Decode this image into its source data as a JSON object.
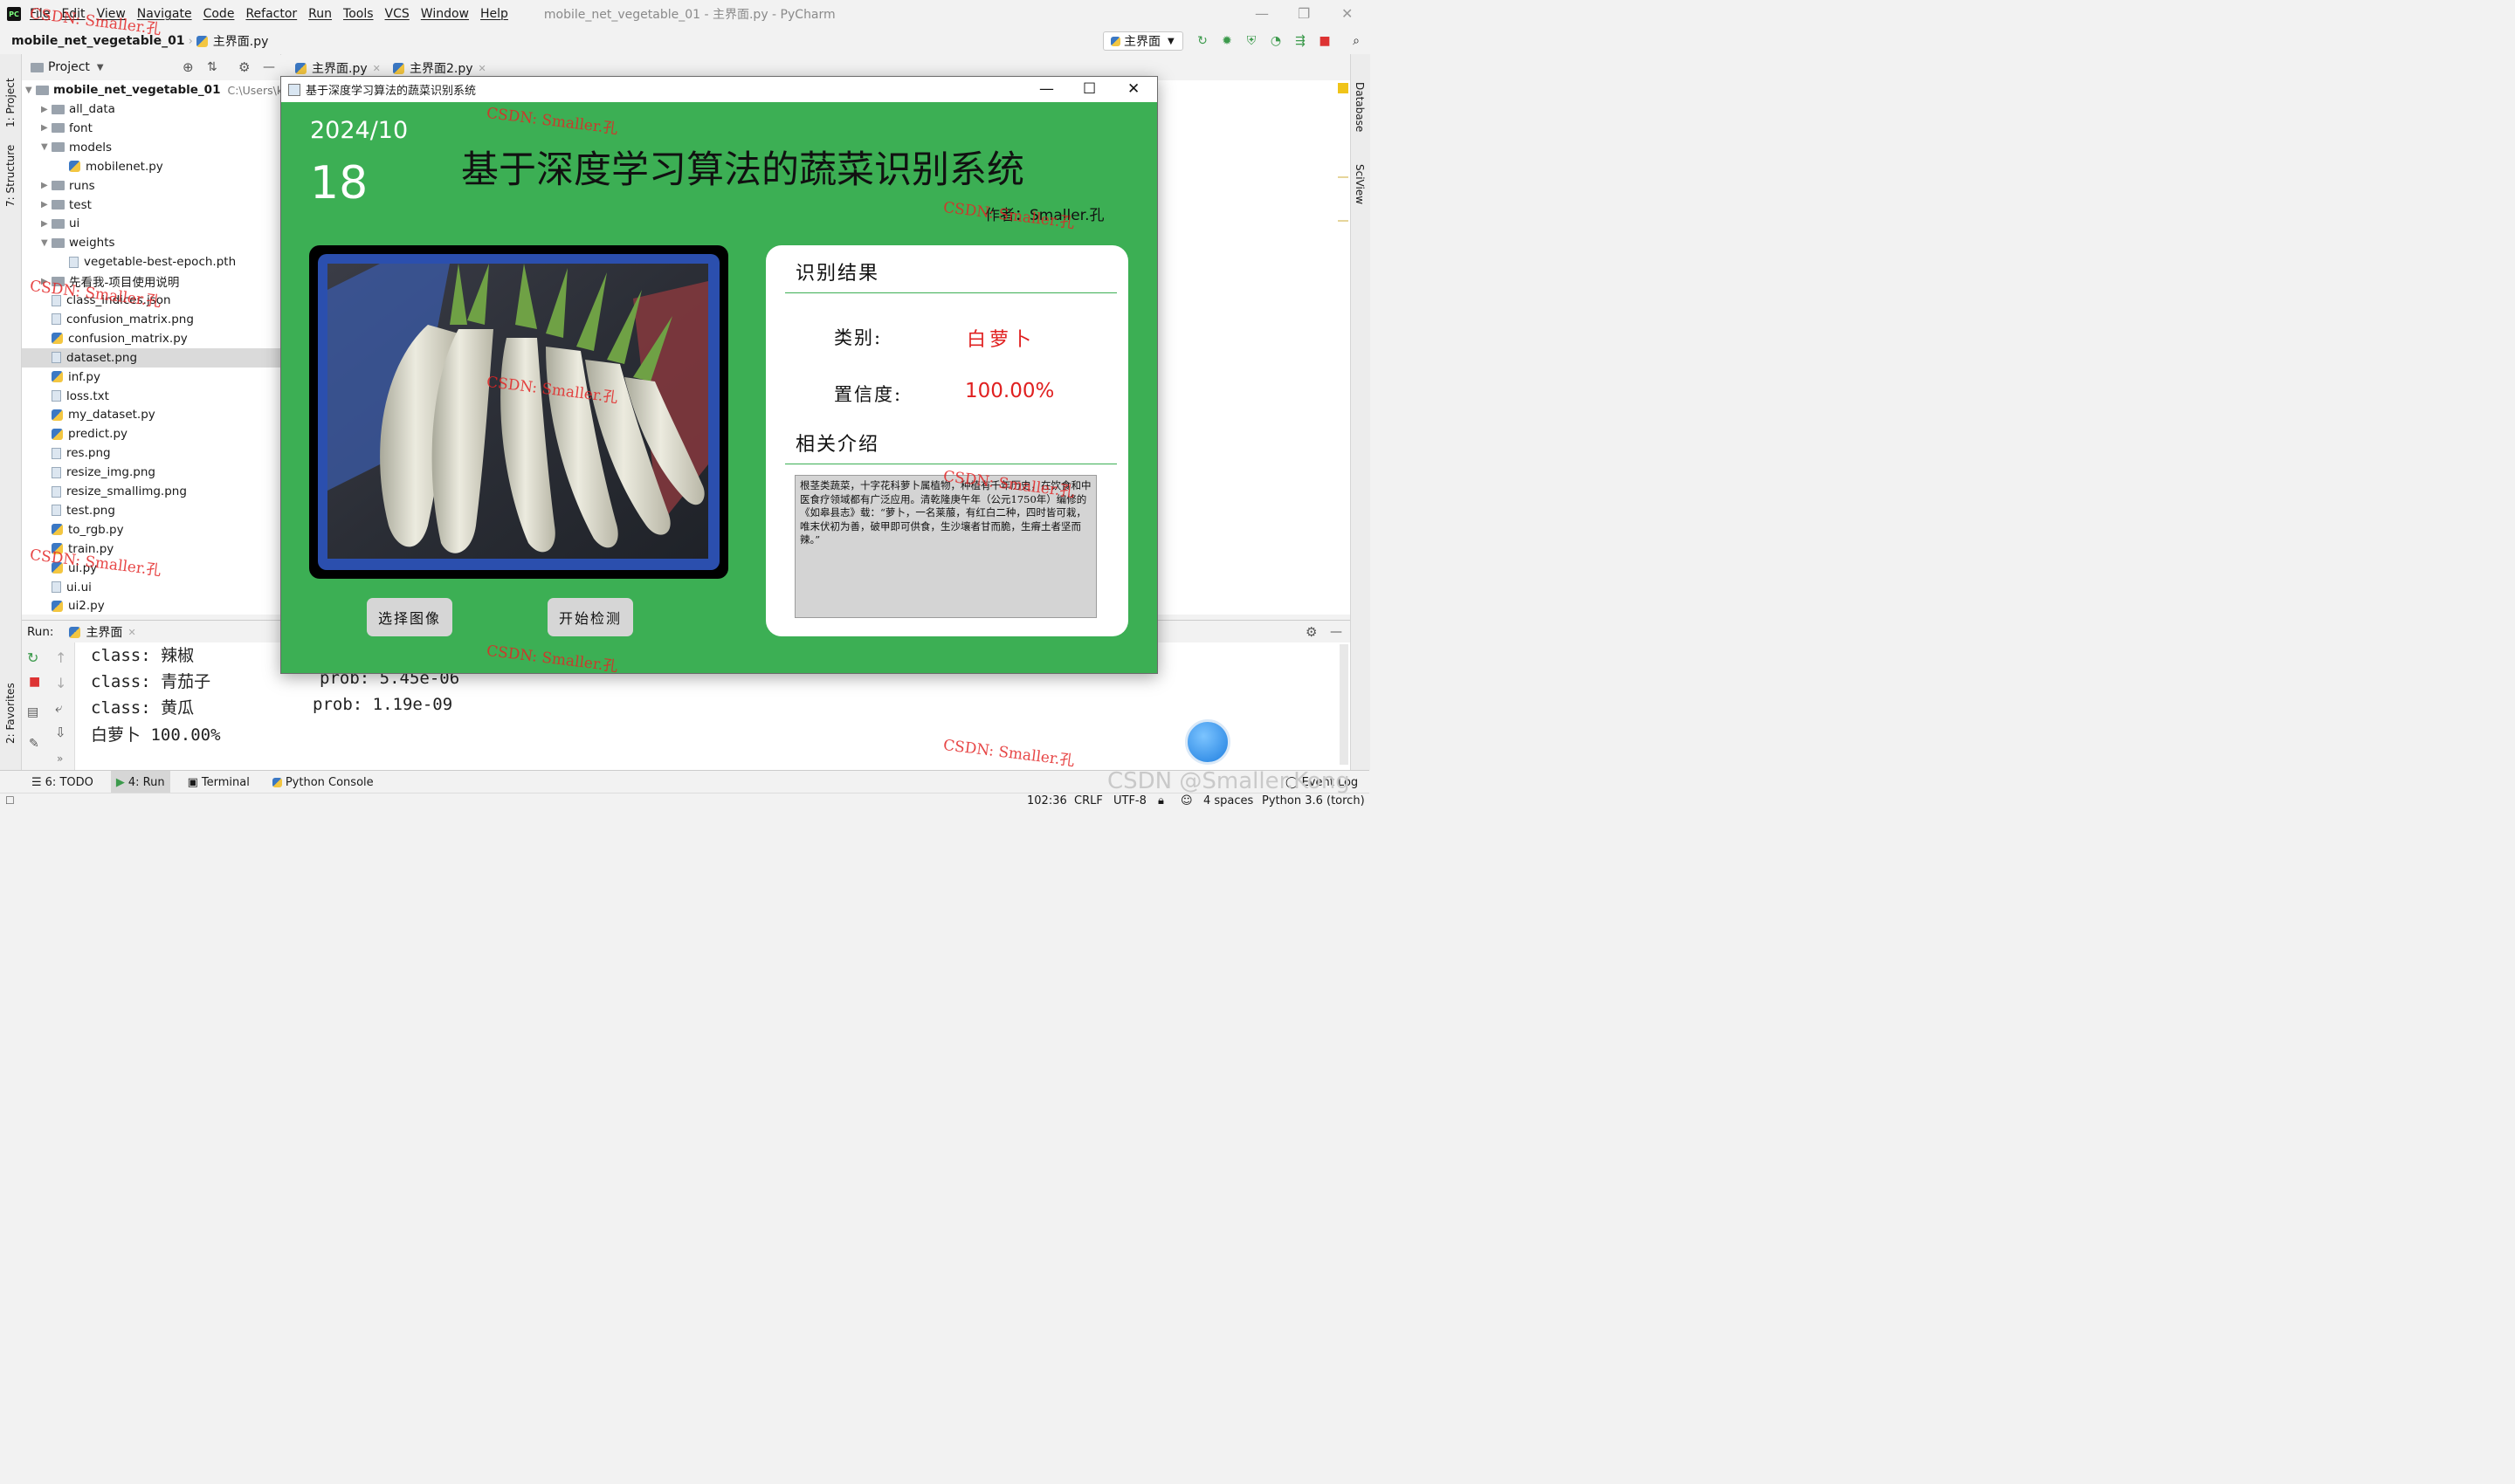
{
  "ide": {
    "menu": [
      "File",
      "Edit",
      "View",
      "Navigate",
      "Code",
      "Refactor",
      "Run",
      "Tools",
      "VCS",
      "Window",
      "Help"
    ],
    "window_title": "mobile_net_vegetable_01 - 主界面.py - PyCharm",
    "breadcrumb_project": "mobile_net_vegetable_01",
    "breadcrumb_file": "主界面.py",
    "run_config": "主界面",
    "project_panel_label": "Project",
    "left_stripe": [
      "1: Project",
      "7: Structure",
      "2: Favorites"
    ],
    "right_stripe": [
      "Database",
      "SciView"
    ],
    "tree": {
      "root_name": "mobile_net_vegetable_01",
      "root_path": "C:\\Users\\kon",
      "items": [
        {
          "label": "all_data",
          "type": "folder",
          "level": 1,
          "expanded": false
        },
        {
          "label": "font",
          "type": "folder",
          "level": 1,
          "expanded": false
        },
        {
          "label": "models",
          "type": "folder",
          "level": 1,
          "expanded": true
        },
        {
          "label": "mobilenet.py",
          "type": "py",
          "level": 2
        },
        {
          "label": "runs",
          "type": "folder",
          "level": 1,
          "expanded": false
        },
        {
          "label": "test",
          "type": "folder",
          "level": 1,
          "expanded": false
        },
        {
          "label": "ui",
          "type": "folder",
          "level": 1,
          "expanded": false
        },
        {
          "label": "weights",
          "type": "folder",
          "level": 1,
          "expanded": true
        },
        {
          "label": "vegetable-best-epoch.pth",
          "type": "file",
          "level": 2
        },
        {
          "label": "先看我-项目使用说明",
          "type": "folder",
          "level": 1,
          "expanded": false
        },
        {
          "label": "class_indices.json",
          "type": "file",
          "level": 1
        },
        {
          "label": "confusion_matrix.png",
          "type": "file",
          "level": 1
        },
        {
          "label": "confusion_matrix.py",
          "type": "py",
          "level": 1
        },
        {
          "label": "dataset.png",
          "type": "file",
          "level": 1,
          "selected": true
        },
        {
          "label": "inf.py",
          "type": "py",
          "level": 1
        },
        {
          "label": "loss.txt",
          "type": "file",
          "level": 1
        },
        {
          "label": "my_dataset.py",
          "type": "py",
          "level": 1
        },
        {
          "label": "predict.py",
          "type": "py",
          "level": 1
        },
        {
          "label": "res.png",
          "type": "file",
          "level": 1
        },
        {
          "label": "resize_img.png",
          "type": "file",
          "level": 1
        },
        {
          "label": "resize_smallimg.png",
          "type": "file",
          "level": 1
        },
        {
          "label": "test.png",
          "type": "file",
          "level": 1
        },
        {
          "label": "to_rgb.py",
          "type": "py",
          "level": 1
        },
        {
          "label": "train.py",
          "type": "py",
          "level": 1
        },
        {
          "label": "ui.py",
          "type": "py",
          "level": 1
        },
        {
          "label": "ui.ui",
          "type": "file",
          "level": 1
        },
        {
          "label": "ui2.py",
          "type": "py",
          "level": 1
        }
      ]
    },
    "editor_tabs": [
      "主界面.py",
      "主界面2.py"
    ],
    "run_label": "Run:",
    "run_tab": "主界面",
    "console_lines": [
      {
        "text": "class: 辣椒",
        "prob": ""
      },
      {
        "text": "class: 青茄子",
        "prob": "prob: 5.45e-06"
      },
      {
        "text": "class: 黄瓜",
        "prob": "prob: 1.19e-09"
      },
      {
        "text": "白萝卜 100.00%",
        "prob": ""
      }
    ],
    "bottom_tabs": [
      "6: TODO",
      "4: Run",
      "Terminal",
      "Python Console",
      "Event Log"
    ],
    "status": {
      "position": "102:36",
      "line_sep": "CRLF",
      "encoding": "UTF-8",
      "indent": "4 spaces",
      "interpreter": "Python 3.6 (torch)"
    }
  },
  "app": {
    "window_title": "基于深度学习算法的蔬菜识别系统",
    "date": "2024/10",
    "day": "18",
    "title": "基于深度学习算法的蔬菜识别系统",
    "author": "作者：Smaller.孔",
    "result_heading": "识别结果",
    "category_label": "类别:",
    "category_value": "白萝卜",
    "confidence_label": "置信度:",
    "confidence_value": "100.00%",
    "intro_heading": "相关介绍",
    "description": "根茎类蔬菜，十字花科萝卜属植物，种植有千年历史，在饮食和中医食疗领域都有广泛应用。清乾隆庚午年（公元1750年）编修的《如皋县志》载：“萝卜，一名莱菔，有红白二种，四时皆可栽，唯末伏初为善，破甲即可供食，生沙壤者甘而脆，生瘠土者坚而辣。”",
    "select_button": "选择图像",
    "detect_button": "开始检测",
    "colors": {
      "background": "#3caf54",
      "result_red": "#e02020",
      "frame_blue": "#2b4fae"
    }
  },
  "watermarks": {
    "red": "CSDN: Smaller.孔",
    "gray": "CSDN @Smaller.Kong"
  }
}
